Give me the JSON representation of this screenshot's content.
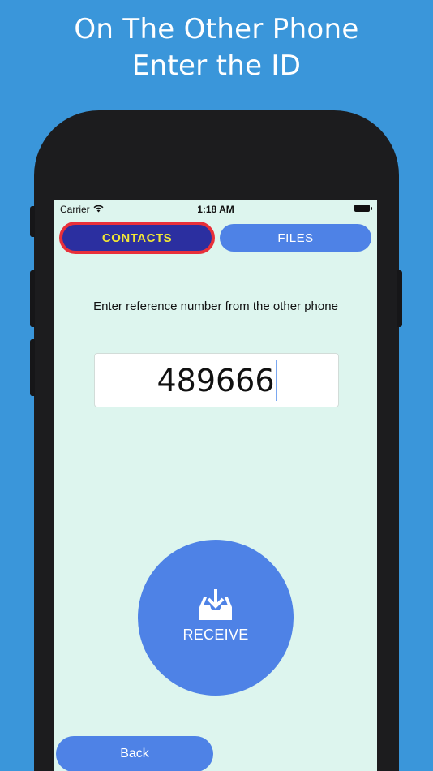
{
  "headline": {
    "line1": "On The Other Phone",
    "line2": "Enter the ID"
  },
  "status_bar": {
    "carrier": "Carrier",
    "time": "1:18 AM"
  },
  "tabs": [
    {
      "label": "CONTACTS",
      "selected": true
    },
    {
      "label": "FILES",
      "selected": false
    }
  ],
  "prompt": "Enter reference number from the other phone",
  "reference_input": {
    "value": "489666"
  },
  "receive_button": {
    "label": "RECEIVE"
  },
  "back_button": {
    "label": "Back"
  },
  "colors": {
    "background": "#3a96da",
    "screen": "#ddf5ee",
    "accent_blue": "#4e82e6",
    "selected_tab": "#2b2fa0",
    "selected_tab_text": "#f2e635",
    "selected_tab_border": "#e8303a"
  }
}
